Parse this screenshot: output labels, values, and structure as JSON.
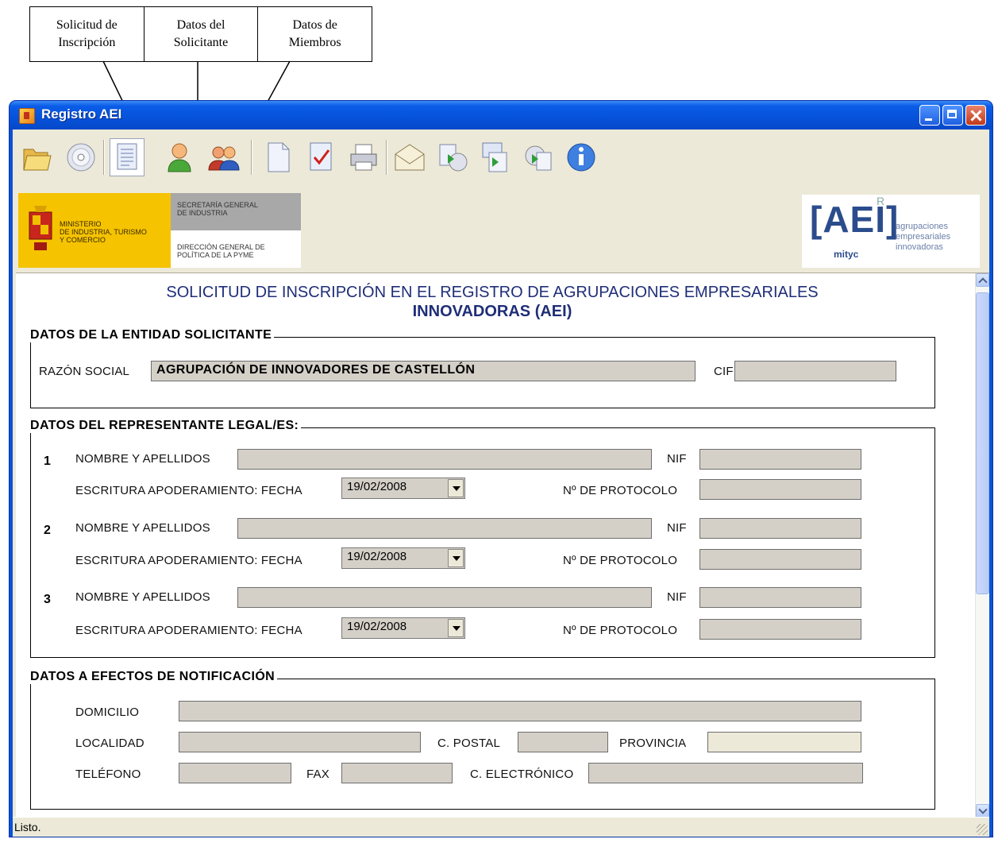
{
  "callouts": [
    {
      "label": "Solicitud de\nInscripción"
    },
    {
      "label": "Datos del\nSolicitante"
    },
    {
      "label": "Datos de\nMiembros"
    }
  ],
  "window": {
    "title": "Registro AEI"
  },
  "toolbar": {
    "buttons": [
      {
        "icon": "open-folder-icon"
      },
      {
        "icon": "cd-icon"
      },
      {
        "icon": "document-form-icon",
        "pressed": true
      },
      {
        "icon": "user-icon"
      },
      {
        "icon": "users-icon"
      },
      {
        "icon": "new-document-icon"
      },
      {
        "icon": "checklist-icon"
      },
      {
        "icon": "printer-icon"
      },
      {
        "icon": "mail-icon"
      },
      {
        "icon": "export-cd-icon"
      },
      {
        "icon": "export-card-icon"
      },
      {
        "icon": "import-icon"
      },
      {
        "icon": "info-icon"
      }
    ]
  },
  "banner": {
    "ministry": "MINISTERIO\nDE INDUSTRIA, TURISMO\nY COMERCIO",
    "secretaria": "SECRETARÍA GENERAL\nDE INDUSTRIA",
    "direccion": "DIRECCIÓN GENERAL DE\nPOLÍTICA DE LA PYME",
    "aei_logo": "AEI",
    "aei_r": "R",
    "aei_mityc": "mityc",
    "aei_desc": "agrupaciones\nempresariales\ninnovadoras"
  },
  "form": {
    "title_line1": "SOLICITUD DE INSCRIPCIÓN EN EL REGISTRO DE AGRUPACIONES EMPRESARIALES",
    "title_line2": "INNOVADORAS (AEI)",
    "entidad": {
      "legend": "DATOS DE LA ENTIDAD SOLICITANTE",
      "razon_label": "RAZÓN SOCIAL",
      "razon_value": "AGRUPACIÓN DE INNOVADORES DE CASTELLÓN",
      "cif_label": "CIF",
      "cif_value": ""
    },
    "representantes": {
      "legend": "DATOS DEL REPRESENTANTE LEGAL/ES:",
      "nombre_label": "NOMBRE Y APELLIDOS",
      "nif_label": "NIF",
      "escritura_label": "ESCRITURA APODERAMIENTO: FECHA",
      "protocolo_label": "Nº DE PROTOCOLO",
      "items": [
        {
          "num": "1",
          "fecha": "19/02/2008"
        },
        {
          "num": "2",
          "fecha": "19/02/2008"
        },
        {
          "num": "3",
          "fecha": "19/02/2008"
        }
      ]
    },
    "notificacion": {
      "legend": "DATOS A EFECTOS DE NOTIFICACIÓN",
      "domicilio_label": "DOMICILIO",
      "localidad_label": "LOCALIDAD",
      "cpostal_label": "C. POSTAL",
      "provincia_label": "PROVINCIA",
      "telefono_label": "TELÉFONO",
      "fax_label": "FAX",
      "correo_label": "C. ELECTRÓNICO"
    }
  },
  "status": {
    "text": "Listo."
  }
}
